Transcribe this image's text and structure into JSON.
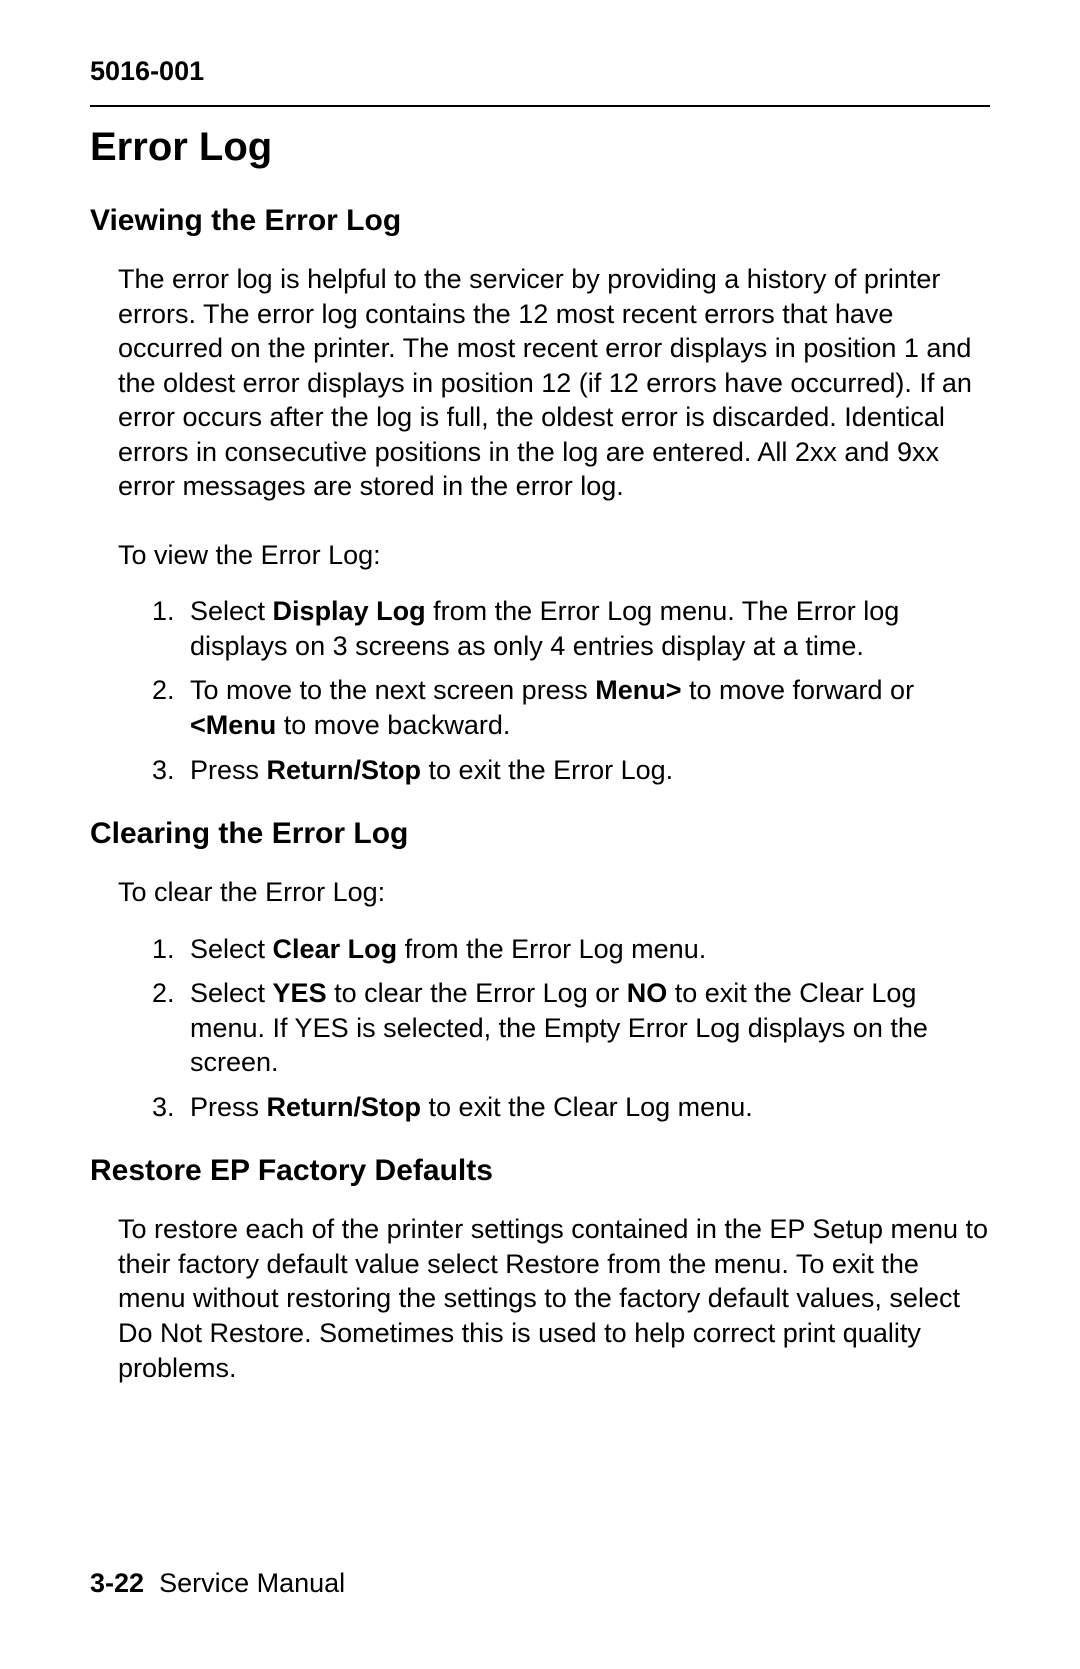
{
  "header": {
    "doc_number": "5016-001"
  },
  "title": "Error Log",
  "sections": {
    "viewing": {
      "heading": "Viewing the Error Log",
      "intro": "The error log is helpful to the servicer by providing a history of printer errors. The error log contains the 12 most recent errors that have occurred on the printer. The most recent error displays in position 1 and the oldest error displays in position 12 (if 12 errors have occurred). If an error occurs after the log is full, the oldest error is discarded. Identical errors in consecutive positions in the log are entered. All 2xx and 9xx error messages are stored in the error log.",
      "lead": "To view the Error Log:",
      "steps": {
        "s1a": "Select ",
        "s1b": "Display Log",
        "s1c": " from the Error Log menu. The Error log displays on 3 screens as only 4 entries display at a time.",
        "s2a": "To move to the next screen press ",
        "s2b": "Menu>",
        "s2c": " to move forward or ",
        "s2d": "<Menu",
        "s2e": " to move backward.",
        "s3a": "Press ",
        "s3b": "Return/Stop",
        "s3c": " to exit the Error Log."
      }
    },
    "clearing": {
      "heading": "Clearing the Error Log",
      "lead": "To clear the Error Log:",
      "steps": {
        "s1a": "Select ",
        "s1b": "Clear Log",
        "s1c": " from the Error Log menu.",
        "s2a": "Select ",
        "s2b": "YES",
        "s2c": " to clear the Error Log or ",
        "s2d": "NO",
        "s2e": " to exit the Clear Log menu. If YES is selected, the Empty Error Log displays on the screen.",
        "s3a": "Press ",
        "s3b": "Return/Stop",
        "s3c": " to exit the Clear Log menu."
      }
    },
    "restore": {
      "heading": "Restore EP Factory Defaults",
      "para": "To restore each of the printer settings contained in the EP Setup menu to their factory default value select Restore from the menu. To exit the menu without restoring the settings to the factory default values, select Do Not Restore. Sometimes this is used to help correct print quality problems."
    }
  },
  "footer": {
    "page": "3-22",
    "label": "Service Manual"
  }
}
